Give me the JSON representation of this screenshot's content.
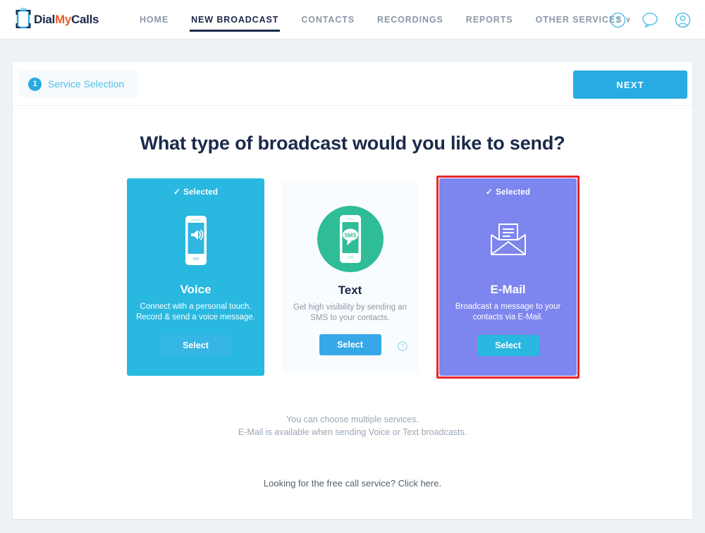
{
  "brand": {
    "name_part1": "Dial",
    "name_part2": "My",
    "name_part3": "Calls",
    "color_dark": "#1b2a4a",
    "color_orange": "#f15a29",
    "color_blue": "#29abe2"
  },
  "nav": {
    "items": [
      {
        "label": "HOME",
        "active": false
      },
      {
        "label": "NEW BROADCAST",
        "active": true
      },
      {
        "label": "CONTACTS",
        "active": false
      },
      {
        "label": "RECORDINGS",
        "active": false
      },
      {
        "label": "REPORTS",
        "active": false
      },
      {
        "label": "OTHER SERVICES",
        "active": false,
        "caret": "∨"
      }
    ],
    "icons": [
      "help-circle-icon",
      "chat-bubble-icon",
      "user-account-icon"
    ]
  },
  "step": {
    "number": "1",
    "label": "Service Selection"
  },
  "toolbar": {
    "next_label": "NEXT"
  },
  "main": {
    "heading": "What type of broadcast would you like to send?",
    "cards": [
      {
        "id": "voice",
        "selected_label": "Selected",
        "check": "✓",
        "title": "Voice",
        "desc_line1": "Connect with a personal touch.",
        "desc_line2": "Record & send a voice message.",
        "button": "Select",
        "bg_color": "#29b8e0",
        "icon": "phone-speaker-icon",
        "is_selected": true
      },
      {
        "id": "text",
        "selected_label": "",
        "check": "",
        "title": "Text",
        "desc_line1": "Get high visibility by sending an",
        "desc_line2": "SMS to your contacts.",
        "button": "Select",
        "bg_color": "#f9fcfe",
        "icon": "phone-sms-icon",
        "is_selected": false
      },
      {
        "id": "email",
        "selected_label": "Selected",
        "check": "✓",
        "title": "E-Mail",
        "desc_line1": "Broadcast a message to your",
        "desc_line2": "contacts via E-Mail.",
        "button": "Select",
        "bg_color": "#7d85ee",
        "icon": "open-envelope-icon",
        "is_selected": true,
        "highlight_border_color": "#e8262a"
      }
    ],
    "notes": {
      "multi_line1": "You can choose multiple services.",
      "multi_line2": "E-Mail is available when sending Voice or Text broadcasts.",
      "free_service": "Looking for the free call service? Click here."
    }
  }
}
